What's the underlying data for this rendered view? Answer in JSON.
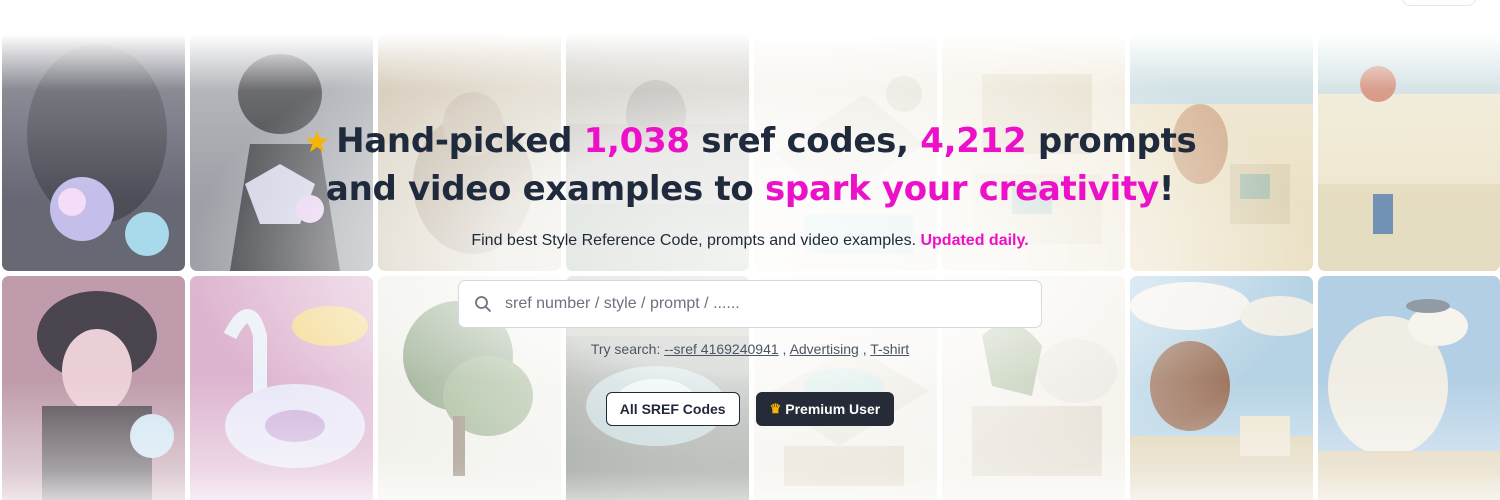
{
  "hero": {
    "star_icon": "star-icon",
    "line1_prefix": "Hand-picked ",
    "sref_count": "1,038",
    "line1_mid": " sref codes, ",
    "prompt_count": "4,212",
    "line1_suffix": " prompts",
    "line2_prefix": "and video examples to ",
    "line2_accent": "spark your creativity",
    "line2_suffix": "!",
    "subline": "Find best Style Reference Code, prompts and video examples. ",
    "subline_accent": "Updated daily."
  },
  "search": {
    "placeholder": "sref number / style / prompt / ......",
    "value": ""
  },
  "try_search": {
    "label": "Try search: ",
    "items": [
      "--sref 4169240941",
      "Advertising",
      "T-shirt"
    ],
    "separator": " , "
  },
  "buttons": {
    "all_sref": "All SREF Codes",
    "premium": "Premium User",
    "premium_icon": "crown-icon"
  },
  "colors": {
    "accent": "#ec11c8",
    "text": "#1f2a3c",
    "dark_button": "#252b37"
  }
}
